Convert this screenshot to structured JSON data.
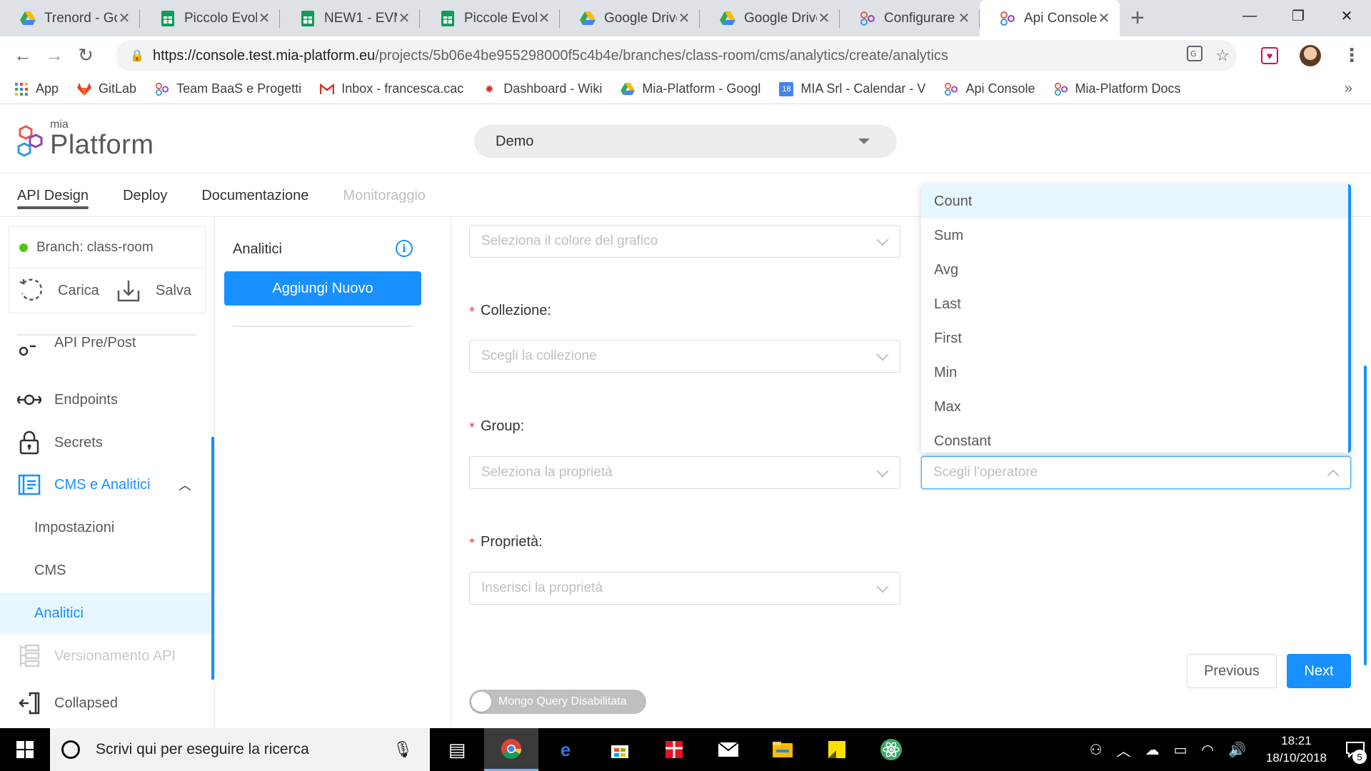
{
  "browser": {
    "tabs": [
      {
        "title": "Trenord - Go",
        "icon": "google-drive-icon"
      },
      {
        "title": "Piccolo Evolu",
        "icon": "google-sheets-icon"
      },
      {
        "title": "NEW1 - EVM",
        "icon": "google-sheets-icon"
      },
      {
        "title": "Piccole Evolu",
        "icon": "google-sheets-icon"
      },
      {
        "title": "Google Drive",
        "icon": "google-drive-icon"
      },
      {
        "title": "Google Drive",
        "icon": "google-drive-icon"
      },
      {
        "title": "Configurare",
        "icon": "mia-platform-icon"
      },
      {
        "title": "Api Console",
        "icon": "mia-platform-icon"
      }
    ],
    "active_tab_index": 7,
    "url": {
      "host": "https://console.test.mia-platform.eu",
      "path": "/projects/5b06e4be955298000f5c4b4e/branches/class-room/cms/analytics/create/analytics"
    },
    "bookmarks": [
      {
        "label": "App",
        "icon": "apps-grid-icon"
      },
      {
        "label": "GitLab",
        "icon": "gitlab-icon"
      },
      {
        "label": "Team BaaS e Progetti",
        "icon": "mia-platform-icon"
      },
      {
        "label": "Inbox - francesca.cac",
        "icon": "gmail-icon"
      },
      {
        "label": "Dashboard - Wiki",
        "icon": "wiki-icon"
      },
      {
        "label": "Mia-Platform - Googl",
        "icon": "google-drive-icon"
      },
      {
        "label": "MIA Srl - Calendar - V",
        "icon": "google-calendar-icon"
      },
      {
        "label": "Api Console",
        "icon": "mia-platform-icon"
      },
      {
        "label": "Mia-Platform Docs",
        "icon": "mia-platform-icon"
      }
    ],
    "bookmarks_overflow": "»",
    "calendar_day": "18"
  },
  "app": {
    "logo_small": "mia",
    "logo_large": "Platform",
    "project": "Demo",
    "menu": [
      {
        "label": "API Design",
        "state": "active"
      },
      {
        "label": "Deploy",
        "state": "normal"
      },
      {
        "label": "Documentazione",
        "state": "normal"
      },
      {
        "label": "Monitoraggio",
        "state": "disabled"
      }
    ],
    "branch": "Branch: class-room",
    "load_label": "Carica",
    "save_label": "Salva",
    "sidebar": {
      "partial_item": "API Pre/Post",
      "endpoints": "Endpoints",
      "secrets": "Secrets",
      "cms_group": "CMS e Analitici",
      "settings": "Impostazioni",
      "cms": "CMS",
      "analytics": "Analitici",
      "versioning": "Versionamento API",
      "collapsed": "Collapsed"
    },
    "panel": {
      "title": "Analitici",
      "add_button": "Aggiungi Nuovo"
    },
    "form": {
      "color_placeholder": "Seleziona il colore del grafico",
      "collection_label": "Collezione",
      "collection_placeholder": "Scegli la collezione",
      "group_label": "Group",
      "group_placeholder": "Seleziona la proprietà",
      "operator_placeholder": "Scegli l'operatore",
      "property_label": "Proprietà",
      "property_placeholder": "Inserisci la proprietà",
      "label_suffix": ":",
      "required_mark": "*",
      "previous": "Previous",
      "next": "Next",
      "mongo_toggle": "Mongo Query Disabilitata",
      "mongo_enabled": false
    },
    "operator_options": [
      "Count",
      "Sum",
      "Avg",
      "Last",
      "First",
      "Min",
      "Max",
      "Constant"
    ],
    "highlighted_option": "Count",
    "accent_color": "#1890ff"
  },
  "taskbar": {
    "search_placeholder": "Scrivi qui per eseguire la ricerca",
    "time": "18:21",
    "date": "18/10/2018",
    "notifications": "5"
  }
}
